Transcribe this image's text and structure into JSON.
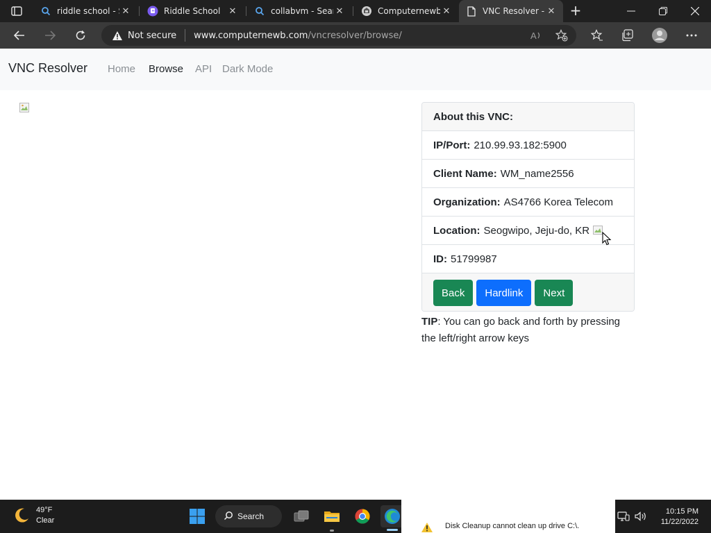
{
  "browser": {
    "tabs": [
      {
        "title": "riddle school - Search",
        "favicon": "search-icon"
      },
      {
        "title": "Riddle School",
        "favicon": "twitch-icon"
      },
      {
        "title": "collabvm - Search",
        "favicon": "search-icon"
      },
      {
        "title": "Computernewb",
        "favicon": "site-logo-icon"
      },
      {
        "title": "VNC Resolver - Browse",
        "favicon": "page-icon"
      }
    ],
    "security_label": "Not secure",
    "url_host": "www.computernewb.com",
    "url_path": "/vncresolver/browse/"
  },
  "site": {
    "brand": "VNC Resolver",
    "nav": [
      "Home",
      "Browse",
      "API",
      "Dark Mode"
    ],
    "active_nav": "Browse"
  },
  "vnc_card": {
    "header": "About this VNC:",
    "rows": [
      {
        "label": "IP/Port:",
        "value": "210.99.93.182:5900"
      },
      {
        "label": "Client Name:",
        "value": "WM_name2556"
      },
      {
        "label": "Organization:",
        "value": "AS4766 Korea Telecom"
      },
      {
        "label": "Location:",
        "value": "Seogwipo, Jeju-do, KR"
      },
      {
        "label": "ID:",
        "value": "51799987"
      }
    ],
    "buttons": {
      "back": "Back",
      "hardlink": "Hardlink",
      "next": "Next"
    }
  },
  "tip": {
    "label": "TIP",
    "text": ": You can go back and forth by pressing the left/right arrow keys"
  },
  "taskbar": {
    "weather_temp": "49°F",
    "weather_desc": "Clear",
    "search_label": "Search",
    "notification": "Disk Cleanup cannot clean up drive C:\\.",
    "time": "10:15 PM",
    "date": "11/22/2022"
  },
  "colors": {
    "btn_green": "#198754",
    "btn_blue": "#0d6efd",
    "nav_bg": "#f8f9fa"
  }
}
